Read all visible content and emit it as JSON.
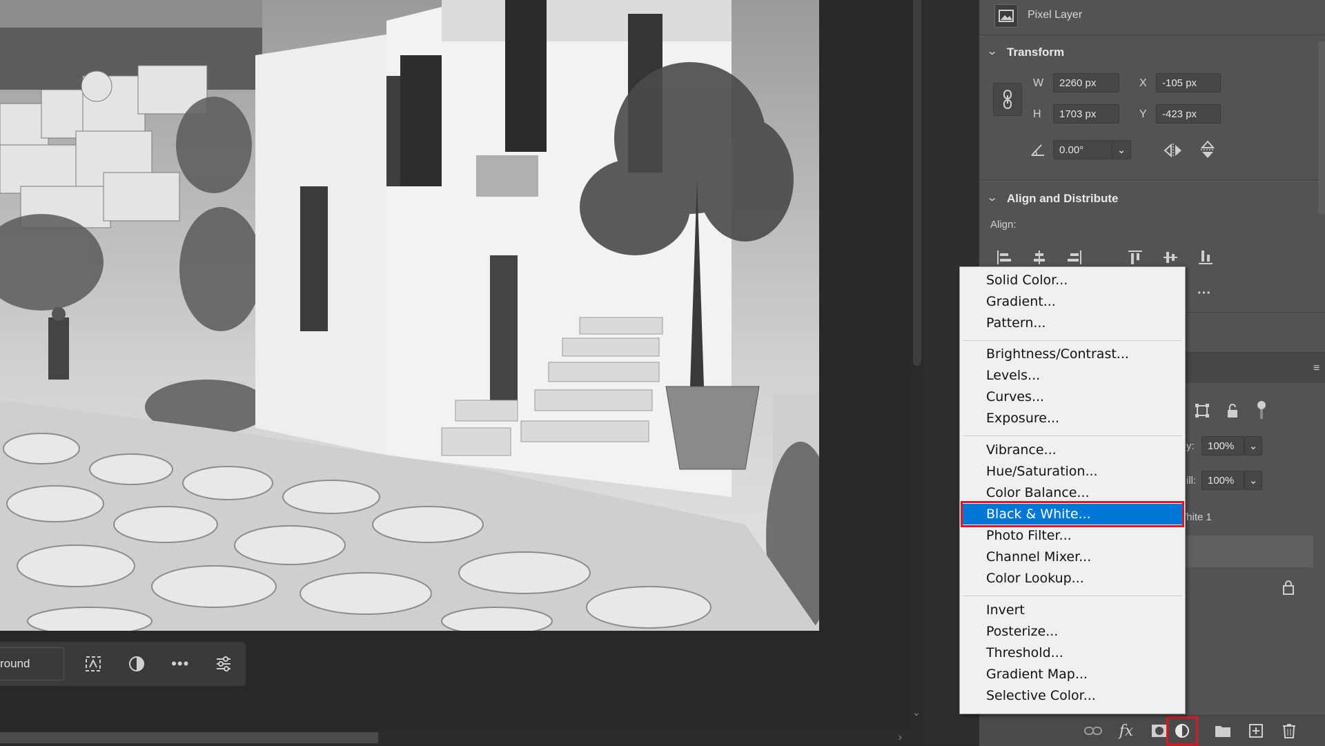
{
  "panel": {
    "layer_kind": "Pixel Layer",
    "transform": {
      "title": "Transform",
      "w_label": "W",
      "w_value": "2260 px",
      "x_label": "X",
      "x_value": "-105 px",
      "h_label": "H",
      "h_value": "1703 px",
      "y_label": "Y",
      "y_value": "-423 px",
      "angle_value": "0.00°"
    },
    "align": {
      "title": "Align and Distribute",
      "label": "Align:",
      "more": "···"
    },
    "layers": {
      "opacity_label_partial": "y:",
      "opacity_value": "100%",
      "fill_label_partial": "ill:",
      "fill_value": "100%",
      "layer_name_partial": "/hite 1"
    }
  },
  "taskbar": {
    "label_partial": "round"
  },
  "menu": {
    "groups": [
      [
        "Solid Color...",
        "Gradient...",
        "Pattern..."
      ],
      [
        "Brightness/Contrast...",
        "Levels...",
        "Curves...",
        "Exposure..."
      ],
      [
        "Vibrance...",
        "Hue/Saturation...",
        "Color Balance...",
        "Black & White...",
        "Photo Filter...",
        "Channel Mixer...",
        "Color Lookup..."
      ],
      [
        "Invert",
        "Posterize...",
        "Threshold...",
        "Gradient Map...",
        "Selective Color..."
      ]
    ],
    "selected": "Black & White..."
  },
  "colors": {
    "accent_highlight": "#0078d7",
    "annotation_red": "#e0161e",
    "panel_bg": "#535353",
    "canvas_bg": "#282828"
  }
}
